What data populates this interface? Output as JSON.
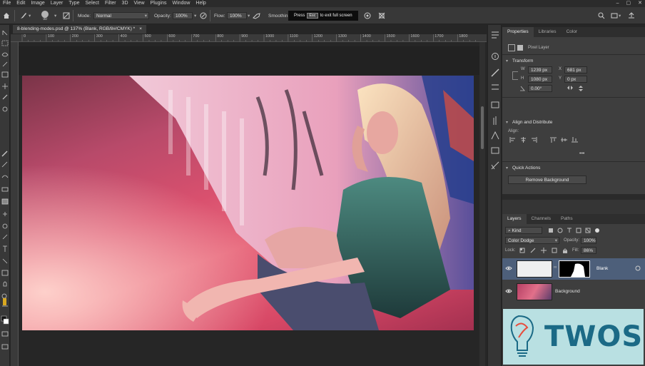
{
  "menubar": {
    "items": [
      "File",
      "Edit",
      "Image",
      "Layer",
      "Type",
      "Select",
      "Filter",
      "3D",
      "View",
      "Plugins",
      "Window",
      "Help"
    ],
    "window_controls": [
      "–",
      "▢",
      "✕"
    ]
  },
  "options_bar": {
    "brush_size": "90",
    "mode_label": "Mode:",
    "mode_value": "Normal",
    "opacity_label": "Opacity:",
    "opacity_value": "100%",
    "flow_label": "Flow:",
    "flow_value": "100%",
    "smoothing_label": "Smoothin",
    "fullscreen_tip": {
      "press": "Press",
      "key": "Esc",
      "rest": "to exit full screen"
    }
  },
  "document": {
    "tab_title": "8-blending-modes.psd @ 137% (Blank, RGB/8#/CMYK) *",
    "close": "×",
    "ruler_ticks": [
      "0",
      "100",
      "200",
      "300",
      "400",
      "500",
      "600",
      "700",
      "800",
      "900",
      "1000",
      "1100",
      "1200",
      "1300",
      "1400",
      "1500",
      "1600",
      "1700",
      "1800"
    ]
  },
  "properties": {
    "tabs": [
      "Properties",
      "Libraries",
      "Color"
    ],
    "layer_type": "Pixel Layer",
    "transform": {
      "title": "Transform",
      "w_label": "W",
      "w_value": "1239 px",
      "h_label": "H",
      "h_value": "1080 px",
      "x_label": "X",
      "x_value": "681 px",
      "y_label": "Y",
      "y_value": "0 px",
      "angle_value": "0.00°"
    },
    "align": {
      "title": "Align and Distribute",
      "align_label": "Align:",
      "more": "•••"
    },
    "quick_actions": {
      "title": "Quick Actions",
      "button": "Remove Background"
    }
  },
  "layers": {
    "tabs": [
      "Layers",
      "Channels",
      "Paths"
    ],
    "filter_kind": "Kind",
    "blend_mode": "Color Dodge",
    "opacity_label": "Opacity:",
    "opacity_value": "100%",
    "lock_label": "Lock:",
    "fill_label": "Fill:",
    "fill_value": "86%",
    "items": [
      {
        "name": "Blank",
        "selected": true
      },
      {
        "name": "Background",
        "selected": false
      }
    ]
  },
  "logo": {
    "text": "TWOS"
  },
  "colors": {
    "panel_bg": "#353535",
    "selected_layer": "#4d5f7a",
    "logo_bg": "#b9e0e2",
    "logo_text": "#1b6a86"
  }
}
